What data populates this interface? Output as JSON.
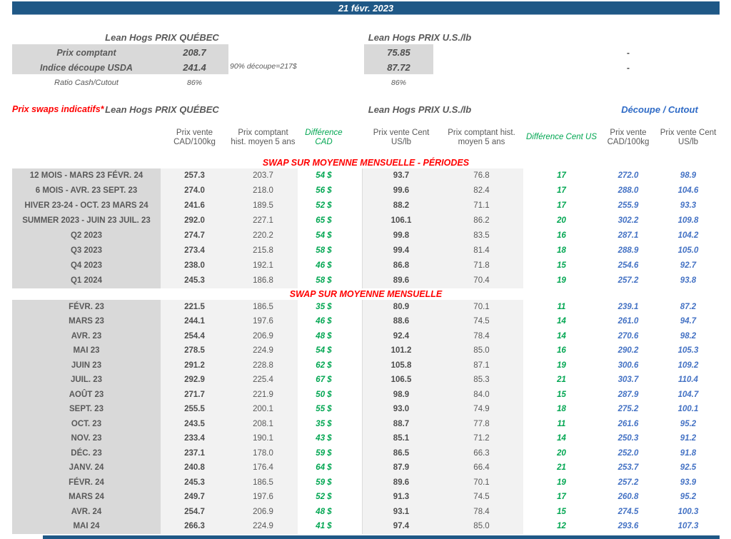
{
  "date_banner": "21 févr. 2023",
  "colors": {
    "banner_blue": "#1F5886",
    "accent_red": "#FF0000",
    "accent_green": "#00A651",
    "accent_blue": "#4472C4",
    "label_gray": "#D9D9D9",
    "band_gray": "#F2F2F2"
  },
  "spot": {
    "qc_header": "Lean Hogs PRIX QUÉBEC",
    "us_header": "Lean Hogs PRIX U.S./lb",
    "rows": [
      {
        "label": "Prix comptant",
        "qc": "208.7",
        "note": "",
        "us": "75.85",
        "cutout": "-"
      },
      {
        "label": "Indice découpe USDA",
        "qc": "241.4",
        "note": "90% découpe=217$",
        "us": "87.72",
        "cutout": "-"
      },
      {
        "label": "Ratio Cash/Cutout",
        "qc": "86%",
        "note": "",
        "us": "86%",
        "cutout": ""
      }
    ]
  },
  "swaps": {
    "title": "Prix swaps indicatifs*",
    "qc_group_header": "Lean Hogs PRIX QUÉBEC",
    "us_group_header": "Lean Hogs PRIX U.S./lb",
    "cutout_group_header": "Découpe / Cutout",
    "column_headers": [
      "Prix vente CAD/100kg",
      "Prix comptant hist. moyen 5 ans",
      "Différence CAD",
      "Prix vente Cent US/lb",
      "Prix comptant hist. moyen 5 ans",
      "Différence Cent US",
      "Prix vente CAD/100kg",
      "Prix vente Cent US/lb"
    ],
    "sections": [
      {
        "title": "SWAP SUR MOYENNE MENSUELLE - PÉRIODES",
        "rows": [
          {
            "label": "12 MOIS - MARS 23 FÉVR. 24",
            "values": [
              "257.3",
              "203.7",
              "54 $",
              "93.7",
              "76.8",
              "17",
              "272.0",
              "98.9"
            ]
          },
          {
            "label": "6 MOIS - AVR. 23 SEPT. 23",
            "values": [
              "274.0",
              "218.0",
              "56 $",
              "99.6",
              "82.4",
              "17",
              "288.0",
              "104.6"
            ]
          },
          {
            "label": "HIVER 23-24 -  OCT. 23 MARS 24",
            "values": [
              "241.6",
              "189.5",
              "52 $",
              "88.2",
              "71.1",
              "17",
              "255.9",
              "93.3"
            ]
          },
          {
            "label": "SUMMER 2023 - JUIN 23 JUIL. 23",
            "values": [
              "292.0",
              "227.1",
              "65 $",
              "106.1",
              "86.2",
              "20",
              "302.2",
              "109.8"
            ]
          },
          {
            "label": "Q2 2023",
            "values": [
              "274.7",
              "220.2",
              "54 $",
              "99.8",
              "83.5",
              "16",
              "287.1",
              "104.2"
            ]
          },
          {
            "label": "Q3 2023",
            "values": [
              "273.4",
              "215.8",
              "58 $",
              "99.4",
              "81.4",
              "18",
              "288.9",
              "105.0"
            ]
          },
          {
            "label": "Q4 2023",
            "values": [
              "238.0",
              "192.1",
              "46 $",
              "86.8",
              "71.8",
              "15",
              "254.6",
              "92.7"
            ]
          },
          {
            "label": "Q1 2024",
            "values": [
              "245.3",
              "186.8",
              "58 $",
              "89.6",
              "70.4",
              "19",
              "257.2",
              "93.8"
            ]
          }
        ]
      },
      {
        "title": "SWAP SUR MOYENNE MENSUELLE",
        "rows": [
          {
            "label": "FÉVR. 23",
            "values": [
              "221.5",
              "186.5",
              "35 $",
              "80.9",
              "70.1",
              "11",
              "239.1",
              "87.2"
            ]
          },
          {
            "label": "MARS 23",
            "values": [
              "244.1",
              "197.6",
              "46 $",
              "88.6",
              "74.5",
              "14",
              "261.0",
              "94.7"
            ]
          },
          {
            "label": "AVR. 23",
            "values": [
              "254.4",
              "206.9",
              "48 $",
              "92.4",
              "78.4",
              "14",
              "270.6",
              "98.2"
            ]
          },
          {
            "label": "MAI 23",
            "values": [
              "278.5",
              "224.9",
              "54 $",
              "101.2",
              "85.0",
              "16",
              "290.2",
              "105.3"
            ]
          },
          {
            "label": "JUIN 23",
            "values": [
              "291.2",
              "228.8",
              "62 $",
              "105.8",
              "87.1",
              "19",
              "300.6",
              "109.2"
            ]
          },
          {
            "label": "JUIL. 23",
            "values": [
              "292.9",
              "225.4",
              "67 $",
              "106.5",
              "85.3",
              "21",
              "303.7",
              "110.4"
            ]
          },
          {
            "label": "AOÛT 23",
            "values": [
              "271.7",
              "221.9",
              "50 $",
              "98.9",
              "84.0",
              "15",
              "287.9",
              "104.7"
            ]
          },
          {
            "label": "SEPT. 23",
            "values": [
              "255.5",
              "200.1",
              "55 $",
              "93.0",
              "74.9",
              "18",
              "275.2",
              "100.1"
            ]
          },
          {
            "label": "OCT. 23",
            "values": [
              "243.5",
              "208.1",
              "35 $",
              "88.7",
              "77.8",
              "11",
              "261.6",
              "95.2"
            ]
          },
          {
            "label": "NOV. 23",
            "values": [
              "233.4",
              "190.1",
              "43 $",
              "85.1",
              "71.2",
              "14",
              "250.3",
              "91.2"
            ]
          },
          {
            "label": "DÉC. 23",
            "values": [
              "237.1",
              "178.0",
              "59 $",
              "86.5",
              "66.3",
              "20",
              "252.0",
              "91.8"
            ]
          },
          {
            "label": "JANV. 24",
            "values": [
              "240.8",
              "176.4",
              "64 $",
              "87.9",
              "66.4",
              "21",
              "253.7",
              "92.5"
            ]
          },
          {
            "label": "FÉVR. 24",
            "values": [
              "245.3",
              "186.5",
              "59 $",
              "89.6",
              "70.1",
              "19",
              "257.2",
              "93.9"
            ]
          },
          {
            "label": "MARS 24",
            "values": [
              "249.7",
              "197.6",
              "52 $",
              "91.3",
              "74.5",
              "17",
              "260.8",
              "95.2"
            ]
          },
          {
            "label": "AVR. 24",
            "values": [
              "254.7",
              "206.9",
              "48 $",
              "93.1",
              "78.4",
              "15",
              "274.5",
              "100.3"
            ]
          },
          {
            "label": "MAI 24",
            "values": [
              "266.3",
              "224.9",
              "41 $",
              "97.4",
              "85.0",
              "12",
              "293.6",
              "107.3"
            ]
          }
        ]
      }
    ]
  }
}
